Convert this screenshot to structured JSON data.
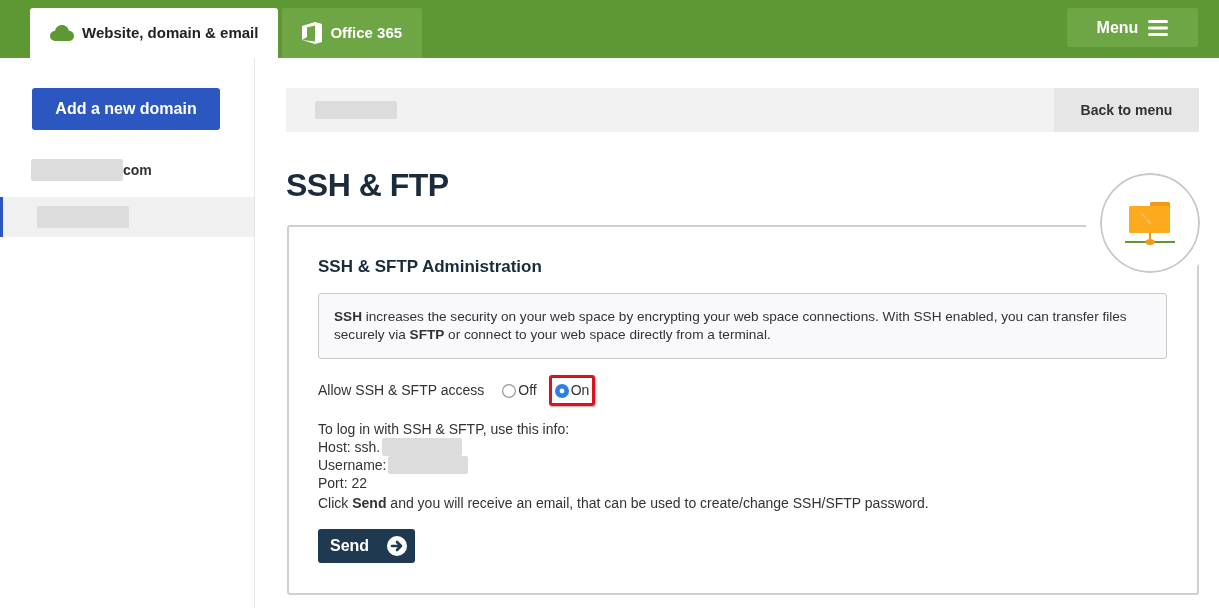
{
  "header": {
    "tabs": [
      {
        "label": "Website, domain & email",
        "selected": true
      },
      {
        "label": "Office 365",
        "selected": false
      }
    ],
    "menu_button": "Menu"
  },
  "sidebar": {
    "add_button": "Add a new domain",
    "domains": [
      {
        "label": "com",
        "redacted": true,
        "selected": false
      },
      {
        "redacted": true,
        "selected": true
      }
    ]
  },
  "breadcrumb": {
    "redacted": true,
    "back_button": "Back to menu"
  },
  "page_title": "SSH & FTP",
  "panel": {
    "title": "SSH & SFTP Administration",
    "info": "**SSH** increases the security on your web space by encrypting your web space connections. With SSH enabled, you can transfer files securely via **SFTP** or connect to your web space directly from a terminal.",
    "access": {
      "label": "Allow SSH & SFTP access",
      "options": [
        {
          "label": "Off",
          "selected": false,
          "highlighted": false
        },
        {
          "label": "On",
          "selected": true,
          "highlighted": true
        }
      ]
    },
    "login_info": [
      {
        "text": "To log in with SSH & SFTP, use this info:",
        "redacted": false
      },
      {
        "text": "Host: ssh.",
        "redacted": true
      },
      {
        "text": "Username:",
        "redacted": true
      },
      {
        "text": "Port: 22",
        "redacted": false
      },
      {
        "text": "Click **Send** and you will receive an email, that can be used to create/change SSH/SFTP password.",
        "redacted": false
      }
    ],
    "send_button": "Send"
  }
}
